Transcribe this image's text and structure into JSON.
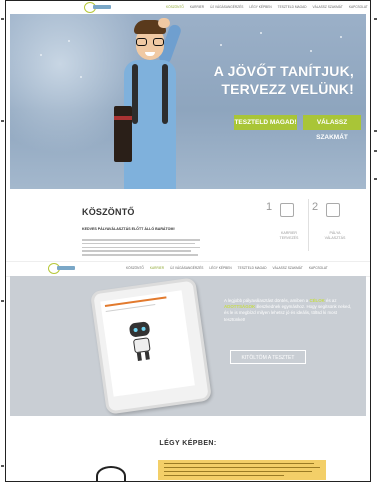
{
  "nav": {
    "logo_alt": "Gyermekek",
    "links": [
      "KÖSZÖNTŐ",
      "KARRIER",
      "ÚJ VÁGÁSANGÉRZÉS",
      "LÉGY KÉPBEN",
      "TESZTELD MAGAD",
      "VÁLASSZ SZAKMÁT",
      "KAPCSOLAT"
    ]
  },
  "hero": {
    "headline_line1": "A JÖVŐT TANÍTJUK,",
    "headline_line2": "TERVEZZ VELÜNK!",
    "button_test": "TESZTELD MAGAD!",
    "button_choose": "VÁLASSZ SZAKMÁT",
    "accent_color": "#a9c537"
  },
  "welcome": {
    "title": "KÖSZÖNTŐ",
    "subtitle": "KEDVES PÁLYAVÁLASZTÁS ELŐTT ÁLLÓ BARÁTOM!",
    "steps": [
      {
        "num": "1",
        "label_line1": "KARRIER",
        "label_line2": "TERVEZÉS"
      },
      {
        "num": "2",
        "label_line1": "PÁLYA",
        "label_line2": "VÁLASZTÁS"
      }
    ]
  },
  "test": {
    "text_part1": "A legjobb pályaválasztást döntés, amiben a ",
    "text_highlight1": "CÉLOK",
    "text_part2": " és az ",
    "text_highlight2": "ADOTTSÁGOK",
    "text_part3": " illeszkednek egymáshoz. Hogy segítsünk neked, és le is megbízd milyen lehetsz jó és ideális, töltsd ki most tesztünket!",
    "button": "KITÖLTÖM A TESZTET"
  },
  "photos": {
    "title": "LÉGY KÉPBEN:"
  }
}
